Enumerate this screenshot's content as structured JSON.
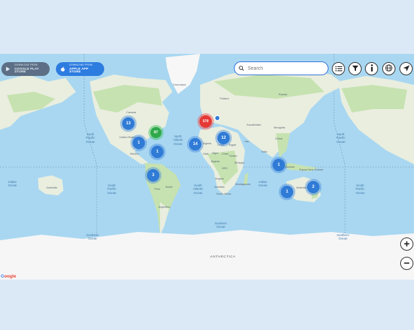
{
  "colors": {
    "ocean": "#a9d7f1",
    "land": "#e9eedf",
    "vegetation": "#c6e2b0",
    "ice": "#f6f6f6",
    "cluster_blue": "#2f7bd6",
    "cluster_green": "#2ea94a",
    "cluster_red": "#e53935",
    "accent": "#2f6fd8"
  },
  "stores": {
    "google": {
      "small": "DOWNLOAD FROM",
      "big": "GOOGLE PLAY STORE",
      "icon": "google-play-icon"
    },
    "apple": {
      "small": "DOWNLOAD FROM",
      "big": "APPLE APP STORE",
      "icon": "apple-icon"
    }
  },
  "search": {
    "placeholder": "Search",
    "value": ""
  },
  "toolbar": [
    {
      "name": "list-icon"
    },
    {
      "name": "filter-icon"
    },
    {
      "name": "info-icon"
    },
    {
      "name": "globe-icon"
    },
    {
      "name": "locate-arrow-icon"
    }
  ],
  "zoom": {
    "in": "+",
    "out": "−"
  },
  "clusters": [
    {
      "id": "north-america-nw",
      "count": "13",
      "color": "blue"
    },
    {
      "id": "north-america-ne",
      "count": "87",
      "color": "green"
    },
    {
      "id": "north-america-s",
      "count": "1",
      "color": "blue"
    },
    {
      "id": "central-america",
      "count": "1",
      "color": "blue"
    },
    {
      "id": "south-america",
      "count": "3",
      "color": "blue"
    },
    {
      "id": "europe",
      "count": "579",
      "color": "red"
    },
    {
      "id": "west-africa",
      "count": "14",
      "color": "blue"
    },
    {
      "id": "middle-east",
      "count": "12",
      "color": "blue"
    },
    {
      "id": "southeast-asia",
      "count": "1",
      "color": "blue"
    },
    {
      "id": "australia-west",
      "count": "1",
      "color": "blue"
    },
    {
      "id": "australia-east",
      "count": "2",
      "color": "blue"
    }
  ],
  "labels": {
    "greenland": "Greenland",
    "canada": "Canada",
    "united_states": "United States",
    "mexico": "Mexico",
    "north_pacific_left": "North\nPacific\nOcean",
    "north_pacific_right": "North\nPacific\nOcean",
    "north_atlantic": "North\nAtlantic\nOcean",
    "south_pacific": "South\nPacific\nOcean",
    "south_atlantic": "South\nAtlantic\nOcean",
    "indian_left": "Indian\nOcean",
    "indian_right": "Indian\nOcean",
    "southern_ocean": "Southern\nOcean",
    "southern_left": "Southern\nOcean",
    "southern_right": "Southern\nOcean",
    "south_pacific_right": "South\nPacific\nOcean",
    "brazil": "Brazil",
    "peru": "Peru",
    "argentina": "Argentina",
    "russia": "Russia",
    "kazakhstan": "Kazakhstan",
    "china": "China",
    "india": "India",
    "mongolia": "Mongolia",
    "iran": "Iran",
    "algeria": "Algeria",
    "libya": "Libya",
    "egypt": "Egypt",
    "mali": "Mali",
    "niger": "Niger",
    "chad": "Chad",
    "sudan": "Sudan",
    "nigeria": "Nigeria",
    "ethiopia": "Ethiopia",
    "drc": "DRC",
    "angola": "Angola",
    "namibia": "Namibia",
    "south_africa": "South Africa",
    "madagascar": "Madagascar",
    "indonesia": "Indonesia",
    "papua_new_guinea": "Papua New Guinea",
    "australia": "Australia",
    "finland": "Finland",
    "antarctica": "ANTARCTICA",
    "google": "Google"
  }
}
